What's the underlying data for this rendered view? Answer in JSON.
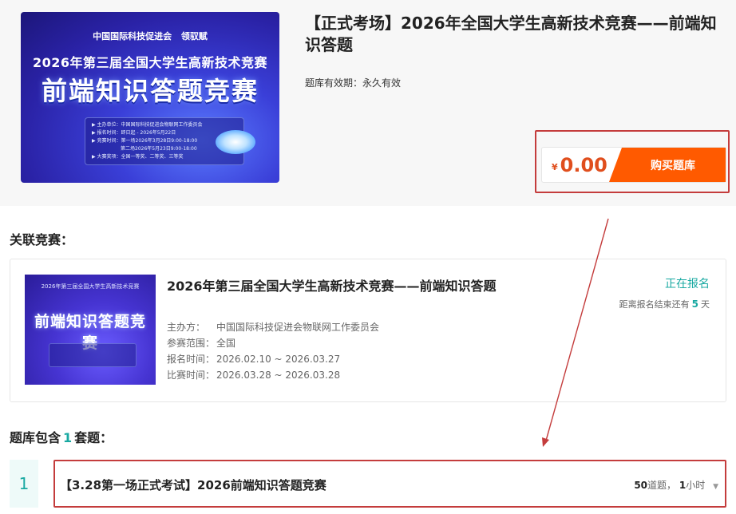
{
  "product": {
    "title": "【正式考场】2026年全国大学生高新技术竞赛——前端知识答题",
    "validity_label": "题库有效期：",
    "validity_value": "永久有效",
    "currency": "¥",
    "price": "0.00",
    "buy_label": "购买题库"
  },
  "banner": {
    "org_logo_text": "中国国际科技促进会",
    "brand_logo_text": "领驭赋",
    "headline": "2026年第三届全国大学生高新技术竞赛",
    "main_title": "前端知识答题竞赛",
    "info_lines": [
      "▶ 主办单位：中国国际科技促进会物联网工作委员会",
      "▶ 报名时间：即日起 - 2026年5月22日",
      "▶ 竞赛时间：第一场2026年3月28日9:00-18:00",
      "　　　　　　第二场2026年5月23日9:00-18:00",
      "▶ 大赛奖项：全国一等奖、二等奖、三等奖"
    ]
  },
  "related": {
    "heading": "关联竞赛：",
    "name": "2026年第三届全国大学生高新技术竞赛——前端知识答题",
    "status": "正在报名",
    "countdown_prefix": "距离报名结束还有",
    "countdown_days": "5",
    "countdown_suffix": "天",
    "thumb_title": "前端知识答题竞赛",
    "thumb_top": "2026年第三届全国大学生高新技术竞赛",
    "meta": [
      {
        "label": "主办方：",
        "value": "中国国际科技促进会物联网工作委员会"
      },
      {
        "label": "参赛范围：",
        "value": "全国"
      },
      {
        "label": "报名时间：",
        "value": "2026.02.10 ~ 2026.03.27"
      },
      {
        "label": "比赛时间：",
        "value": "2026.03.28 ~ 2026.03.28"
      }
    ]
  },
  "papers": {
    "heading_prefix": "题库包含",
    "count": "1",
    "heading_suffix": "套题：",
    "items": [
      {
        "index": "1",
        "title": "【3.28第一场正式考试】2026前端知识答题竞赛",
        "questions": "50",
        "questions_unit": "道题，",
        "duration": "1",
        "duration_unit": "小时"
      }
    ]
  },
  "colors": {
    "accent_teal": "#19a9a2",
    "price_red": "#e04e1d",
    "buy_orange": "#ff5a00",
    "annotation_red": "#c43c3c"
  }
}
